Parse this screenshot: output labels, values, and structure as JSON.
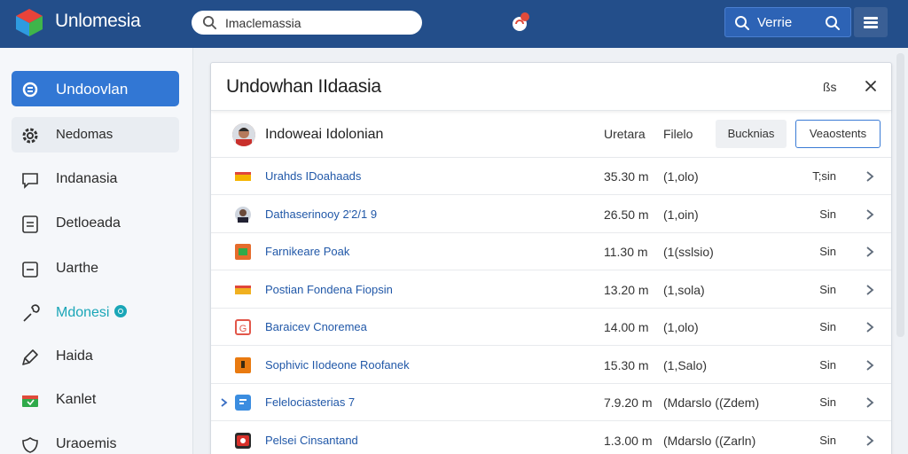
{
  "app": {
    "title": "Unlomesia"
  },
  "search": {
    "value": "Imaclemassia"
  },
  "top_button": {
    "label": "Verrie"
  },
  "sidebar": {
    "items": [
      {
        "label": "Undoovlan",
        "icon": "settings-icon",
        "state": "active"
      },
      {
        "label": "Nedomas",
        "icon": "gear-icon",
        "state": "hover"
      },
      {
        "label": "Indanasia",
        "icon": "message-icon",
        "state": ""
      },
      {
        "label": "Detloeada",
        "icon": "document-icon",
        "state": ""
      },
      {
        "label": "Uarthe",
        "icon": "minus-box-icon",
        "state": ""
      },
      {
        "label": "Mdonesi",
        "icon": "wrench-icon",
        "state": "teal"
      },
      {
        "label": "Haida",
        "icon": "tag-icon",
        "state": ""
      },
      {
        "label": "Kanlet",
        "icon": "folder-icon",
        "state": ""
      },
      {
        "label": "Uraoemis",
        "icon": "shield-icon",
        "state": ""
      }
    ]
  },
  "panel": {
    "title": "Undowhan IIdaasia",
    "extra": "ßs",
    "subhead": {
      "name": "Indoweai Idolonian",
      "col1": "Uretara",
      "col2": "Filelo",
      "btn1": "Bucknias",
      "btn2": "Veaostents"
    },
    "rows": [
      {
        "name": "Urahds IDoahaads",
        "size": "35.30 m",
        "type": "(1,olo)",
        "status": "T;sin",
        "icon": "flag-icon",
        "color": "#f5b400"
      },
      {
        "name": "Dathaserinooy 2'2/1 9",
        "size": "26.50 m",
        "type": "(1,oin)",
        "status": "Sin",
        "icon": "person-icon",
        "color": "#6b4a3a"
      },
      {
        "name": "Farnikeare Poak",
        "size": "11.30 m",
        "type": "(1(sslsio)",
        "status": "Sin",
        "icon": "image-icon",
        "color": "#e56c2c"
      },
      {
        "name": "Postian Fondena Fiopsin",
        "size": "13.20 m",
        "type": "(1,sola)",
        "status": "Sin",
        "icon": "flag-icon",
        "color": "#f0b020"
      },
      {
        "name": "Baraicev Cnoremea",
        "size": "14.00 m",
        "type": "(1,olo)",
        "status": "Sin",
        "icon": "gift-icon",
        "color": "#e2574a"
      },
      {
        "name": "Sophivic IIodeone Roofanek",
        "size": "15.30 m",
        "type": "(1,Salo)",
        "status": "Sin",
        "icon": "box-icon",
        "color": "#e97a10"
      },
      {
        "name": "Felelociasterias 7",
        "size": "7.9.20 m",
        "type": "(Mdarslo ((Zdem)",
        "status": "Sin",
        "icon": "chat-icon",
        "color": "#3b8de0"
      },
      {
        "name": "Pelsei Cinsantand",
        "size": "1.3.00 m",
        "type": "(Mdarslo ((Zarln)",
        "status": "Sin",
        "icon": "camera-icon",
        "color": "#d8302a"
      }
    ]
  }
}
